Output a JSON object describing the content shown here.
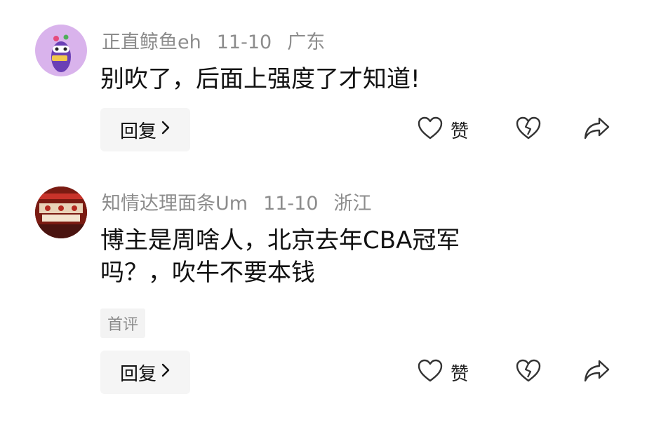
{
  "comments": [
    {
      "username": "正直鲸鱼eh",
      "date": "11-10",
      "location": "广东",
      "text_lines": [
        "别吹了，后面上强度了才知道!"
      ],
      "tag": "",
      "reply_label": "回复",
      "like_label": "赞",
      "avatar_icon": "cartoon-avatar"
    },
    {
      "username": "知情达理面条Um",
      "date": "11-10",
      "location": "浙江",
      "text_lines": [
        "博主是周啥人，北京去年CBA冠军",
        "吗？，吹牛不要本钱"
      ],
      "tag": "首评",
      "reply_label": "回复",
      "like_label": "赞",
      "avatar_icon": "photo-avatar"
    }
  ],
  "colors": {
    "meta": "#8c8c8c",
    "reply_bg": "#f5f5f5",
    "tag_bg": "#f3f3f3"
  },
  "icons": [
    "heart-icon",
    "broken-heart-icon",
    "share-arrow-icon",
    "chevron-right-icon"
  ]
}
